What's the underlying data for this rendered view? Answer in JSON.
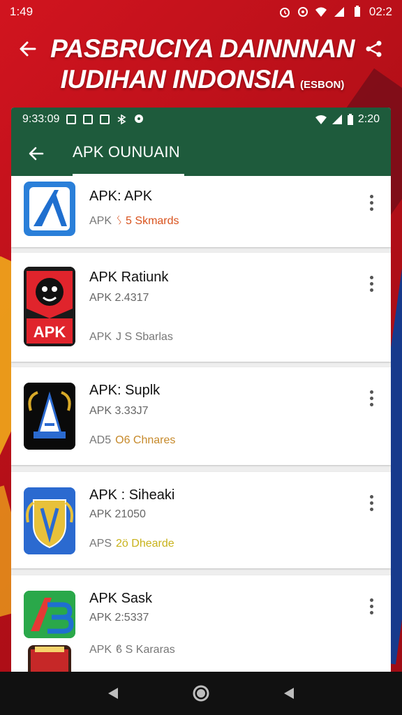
{
  "status_bar": {
    "time": "1:49",
    "clock": "02:2"
  },
  "header": {
    "title_line1": "PASBRUCIYA DAINNNAN",
    "title_line2": "IUDIHAN INDONSIA",
    "title_tag": "(ESBON)"
  },
  "inner_status": {
    "time": "9:33:09",
    "clock": "2:20"
  },
  "app_bar": {
    "title": "APK OUNUAIN"
  },
  "apps": [
    {
      "name": "APK: APK",
      "version": "",
      "meta_prefix": "APK",
      "meta_highlight": "ᛊ 5 Skmards",
      "highlight_color": "#d9531e"
    },
    {
      "name": "APK Ratiunk",
      "version": "APK 2.4317",
      "meta_prefix": "APK",
      "meta_highlight": "J S Sbarlas",
      "highlight_color": "#777777",
      "icon_text": "APK"
    },
    {
      "name": "APK: Suplk",
      "version": "APK 3.33J7",
      "meta_prefix": "AD5",
      "meta_highlight": "O6 Chnares",
      "highlight_color": "#c6892a"
    },
    {
      "name": "APK : Siheaki",
      "version": "APK 21050",
      "meta_prefix": "APS",
      "meta_highlight": "2ö Dhearde",
      "highlight_color": "#777777"
    },
    {
      "name": "APK Sask",
      "version": "APK 2:5337",
      "meta_prefix": "APK",
      "meta_highlight": "ϐ S Kararas",
      "highlight_color": "#777777"
    }
  ],
  "colors": {
    "brand_green": "#1e5b3c",
    "background_red": "#c4121c"
  },
  "icons": [
    "back-arrow-icon",
    "share-icon",
    "more-vert-icon",
    "nav-back-icon",
    "nav-home-icon",
    "nav-recents-icon"
  ]
}
